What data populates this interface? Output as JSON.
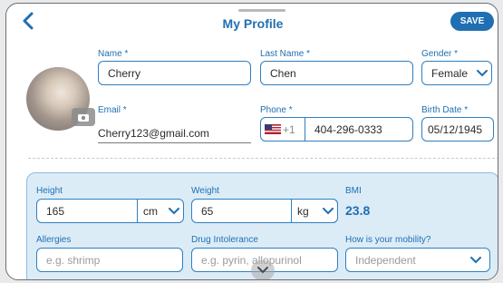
{
  "header": {
    "title": "My Profile",
    "save_label": "SAVE"
  },
  "profile": {
    "name_label": "Name *",
    "name_value": "Cherry",
    "last_name_label": "Last Name *",
    "last_name_value": "Chen",
    "gender_label": "Gender *",
    "gender_value": "Female",
    "email_label": "Email *",
    "email_value": "Cherry123@gmail.com",
    "phone_label": "Phone *",
    "phone_prefix": "+1",
    "phone_value": "404-296-0333",
    "birth_label": "Birth Date *",
    "birth_value": "05/12/1945"
  },
  "health": {
    "height_label": "Height",
    "height_value": "165",
    "height_unit": "cm",
    "weight_label": "Weight",
    "weight_value": "65",
    "weight_unit": "kg",
    "bmi_label": "BMI",
    "bmi_value": "23.8",
    "allergies_label": "Allergies",
    "allergies_placeholder": "e.g. shrimp",
    "drug_label": "Drug Intolerance",
    "drug_placeholder": "e.g. pyrin, allopurinol",
    "mobility_label": "How is your mobility?",
    "mobility_value": "Independent"
  },
  "colors": {
    "accent": "#1f6fb2",
    "panel_bg": "#dcecf7",
    "border": "#2f7fc0"
  },
  "icons": {
    "back": "chevron-left-icon",
    "camera": "camera-icon",
    "flag": "us-flag-icon",
    "dropdown": "chevron-down-icon",
    "scroll": "chevron-down-icon"
  }
}
